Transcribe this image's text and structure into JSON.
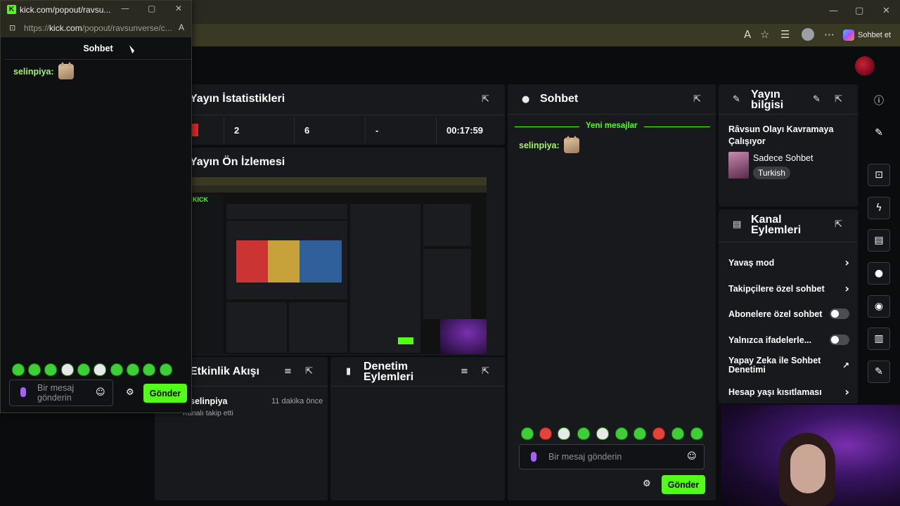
{
  "browser": {
    "window_controls": [
      "—",
      "▢",
      "✕"
    ],
    "copilot_label": "Sohbet et"
  },
  "popout": {
    "title": "kick.com/popout/ravsu...",
    "url_prefix": "https://",
    "url_domain": "kick.com",
    "url_path": "/popout/ravsunverse/c...",
    "header": "Sohbet",
    "message_user": "selinpiya:",
    "input_placeholder": "Bir mesaj gönderin",
    "send_label": "Gönder"
  },
  "stats": {
    "title": "Yayın İstatistikleri",
    "values": [
      "2",
      "6",
      "-",
      "00:17:59"
    ]
  },
  "preview": {
    "title": "Yayın Ön İzlemesi"
  },
  "activity": {
    "title": "Etkinlik Akışı",
    "user": "selinpiya",
    "time": "11 dakika önce",
    "action": "Kanalı takip etti"
  },
  "moderation": {
    "title_line1": "Denetim",
    "title_line2": "Eylemleri"
  },
  "chat": {
    "title": "Sohbet",
    "new_messages": "Yeni mesajlar",
    "message_user": "selinpiya:",
    "input_placeholder": "Bir mesaj gönderin",
    "send_label": "Gönder"
  },
  "stream_info": {
    "title_line1": "Yayın",
    "title_line2": "bilgisi",
    "stream_title": "Râvsun Olayı Kavramaya Çalışıyor",
    "category": "Sadece Sohbet",
    "language": "Turkish"
  },
  "channel_actions": {
    "title_line1": "Kanal",
    "title_line2": "Eylemleri",
    "items": [
      {
        "label": "Yavaş mod",
        "control": "chevron"
      },
      {
        "label": "Takipçilere özel sohbet",
        "control": "chevron"
      },
      {
        "label": "Abonelere özel sohbet",
        "control": "toggle"
      },
      {
        "label": "Yalnızca ifadelerle...",
        "control": "toggle"
      },
      {
        "label": "Yapay Zeka ile Sohbet Denetimi",
        "control": "external"
      },
      {
        "label": "Hesap yaşı kısıtlaması",
        "control": "chevron"
      }
    ]
  },
  "colors": {
    "accent": "#53fc18",
    "panel": "#18191d",
    "username": "#a6f06a"
  }
}
